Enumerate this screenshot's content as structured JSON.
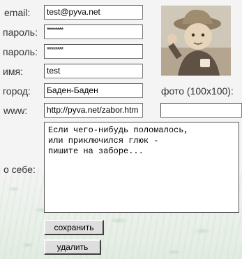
{
  "form": {
    "email_label": "email:",
    "email_value": "test@pyva.net",
    "password_label": "пароль:",
    "password_mask": "********",
    "password_repeat_label": "пароль:",
    "password_repeat_mask": "********",
    "name_label": "имя:",
    "name_value": "test",
    "city_label": "город:",
    "city_value": "Баден-Баден",
    "www_label": "www:",
    "www_value": "http://pyva.net/zabor.htm",
    "about_label": "о себе:",
    "about_value": "Если чего-нибудь поломалось,\nили приключился глюк -\nпишите на заборе...",
    "photo_label": "фото (100x100):",
    "photo_value": ""
  },
  "buttons": {
    "save": "сохранить",
    "delete": "удалить"
  },
  "photo": {
    "icon": "user-photo-child-in-hat",
    "tone": "#a89a86"
  }
}
